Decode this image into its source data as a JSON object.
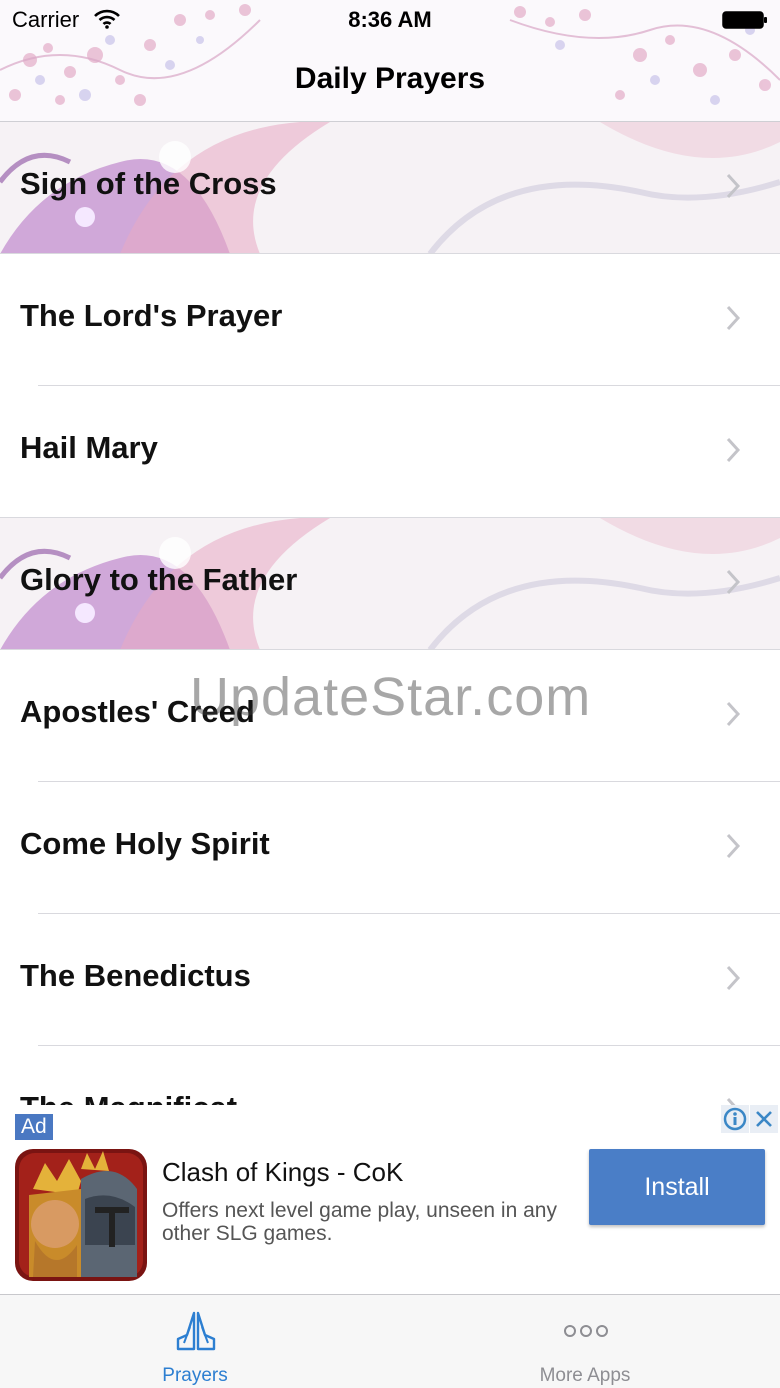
{
  "status_bar": {
    "carrier": "Carrier",
    "time": "8:36 AM"
  },
  "nav": {
    "title": "Daily Prayers"
  },
  "prayers": [
    {
      "label": "Sign of the Cross"
    },
    {
      "label": "The Lord's Prayer"
    },
    {
      "label": "Hail Mary"
    },
    {
      "label": "Glory to the Father"
    },
    {
      "label": "Apostles' Creed"
    },
    {
      "label": "Come Holy Spirit"
    },
    {
      "label": "The Benedictus"
    },
    {
      "label": "The Magnificat"
    }
  ],
  "watermark": "UpdateStar.com",
  "ad": {
    "badge": "Ad",
    "title": "Clash of Kings - CoK",
    "description": "Offers next level game play, unseen in any other SLG games.",
    "install_label": "Install"
  },
  "tabs": [
    {
      "label": "Prayers",
      "icon": "praying-hands-icon",
      "active": true
    },
    {
      "label": "More Apps",
      "icon": "more-dots-icon",
      "active": false
    }
  ],
  "colors": {
    "accent": "#2d7fd1",
    "install_button": "#4a7ec7",
    "ad_badge": "#4a78c2",
    "decor_purple": "#9a5fb5",
    "decor_pink": "#e3aec4"
  }
}
